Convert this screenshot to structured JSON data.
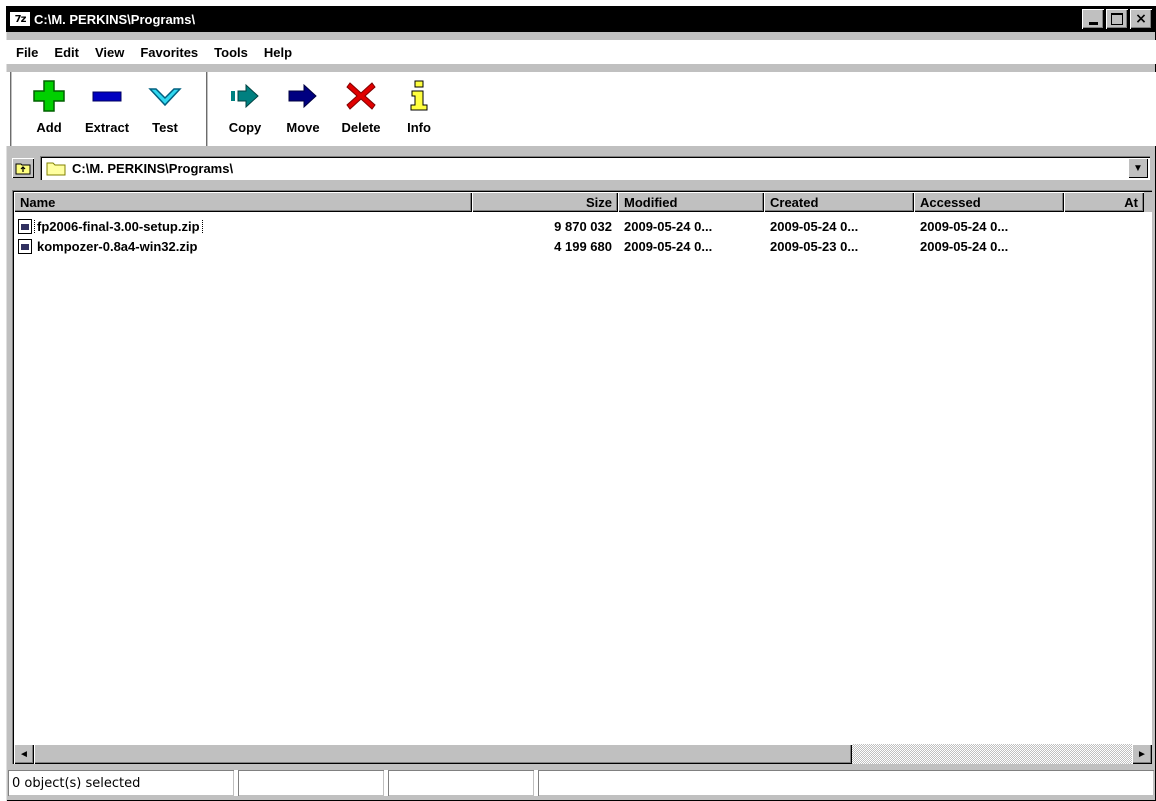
{
  "window": {
    "app_logo": "7z",
    "title": "C:\\M. PERKINS\\Programs\\",
    "controls": {
      "minimize": "",
      "maximize": "",
      "close": "×"
    }
  },
  "menu": [
    "File",
    "Edit",
    "View",
    "Favorites",
    "Tools",
    "Help"
  ],
  "toolbar": {
    "group1": [
      {
        "label": "Add",
        "icon": "add-icon",
        "color": "#00c000"
      },
      {
        "label": "Extract",
        "icon": "extract-icon",
        "color": "#0000c0"
      },
      {
        "label": "Test",
        "icon": "test-icon",
        "color": "#00c0e0"
      }
    ],
    "group2": [
      {
        "label": "Copy",
        "icon": "copy-icon",
        "color": "#008080"
      },
      {
        "label": "Move",
        "icon": "move-icon",
        "color": "#000080"
      },
      {
        "label": "Delete",
        "icon": "delete-icon",
        "color": "#e00000"
      },
      {
        "label": "Info",
        "icon": "info-icon",
        "color": "#c0c000"
      }
    ]
  },
  "address": {
    "path": "C:\\M. PERKINS\\Programs\\",
    "dropdown": "▼"
  },
  "columns": {
    "name": "Name",
    "size": "Size",
    "modified": "Modified",
    "created": "Created",
    "accessed": "Accessed",
    "attributes": "At"
  },
  "files": [
    {
      "name": "fp2006-final-3.00-setup.zip",
      "size": "9 870 032",
      "modified": "2009-05-24 0...",
      "created": "2009-05-24 0...",
      "accessed": "2009-05-24 0..."
    },
    {
      "name": "kompozer-0.8a4-win32.zip",
      "size": "4 199 680",
      "modified": "2009-05-24 0...",
      "created": "2009-05-23 0...",
      "accessed": "2009-05-24 0..."
    }
  ],
  "scrollbar": {
    "left": "◄",
    "right": "►"
  },
  "status": {
    "selected": "0 object(s) selected",
    "pane2": "",
    "pane3": "",
    "pane4": ""
  }
}
